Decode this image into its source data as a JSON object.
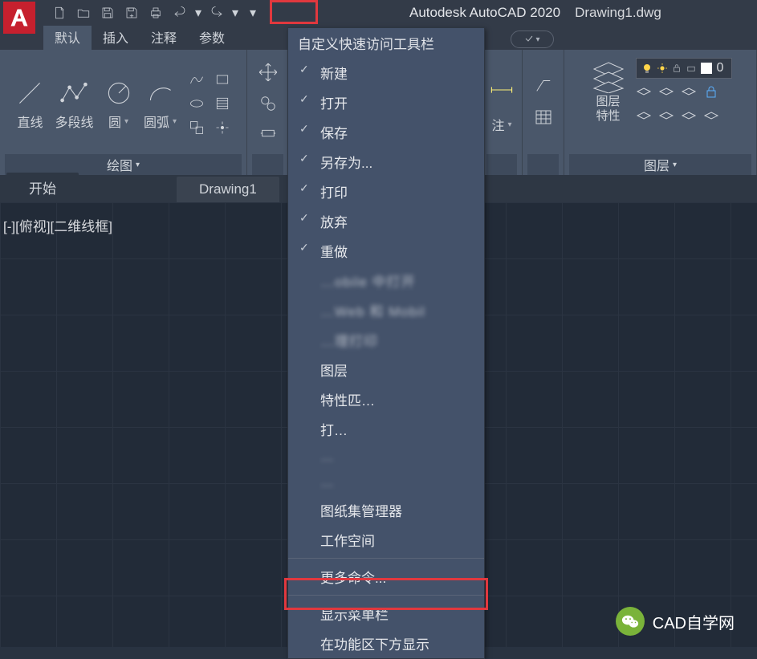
{
  "title": {
    "app": "Autodesk AutoCAD 2020",
    "file": "Drawing1.dwg"
  },
  "app_logo_letter": "A",
  "menutabs": {
    "default": "默认",
    "insert": "插入",
    "annotate": "注释",
    "param": "参数"
  },
  "ribbon": {
    "draw": {
      "line": "直线",
      "pline": "多段线",
      "circle": "圆",
      "arc": "圆弧",
      "group": "绘图"
    },
    "annotate_btn": "注",
    "layer": {
      "props": "图层\n特性",
      "group": "图层",
      "cur_layer": "0"
    }
  },
  "qat_dropdown": {
    "title": "自定义快速访问工具栏",
    "items": [
      {
        "label": "新建",
        "checked": true
      },
      {
        "label": "打开",
        "checked": true
      },
      {
        "label": "保存",
        "checked": true
      },
      {
        "label": "另存为...",
        "checked": true
      },
      {
        "label": "打印",
        "checked": true
      },
      {
        "label": "放弃",
        "checked": true
      },
      {
        "label": "重做",
        "checked": true
      },
      {
        "label": "…obile 中打开",
        "checked": false,
        "blur": true
      },
      {
        "label": "…Web 和 Mobil",
        "checked": false,
        "blur": true
      },
      {
        "label": "…理打印",
        "checked": false,
        "blur": true
      },
      {
        "label": "图层",
        "checked": false
      },
      {
        "label": "特性匹…",
        "checked": false,
        "blur_part": true
      },
      {
        "label": "打…",
        "checked": false,
        "blur_part": true
      },
      {
        "label": "…",
        "checked": false,
        "blur": true
      },
      {
        "label": "…",
        "checked": false,
        "blur": true
      },
      {
        "label": "图纸集管理器",
        "checked": false
      },
      {
        "label": "工作空间",
        "checked": false
      }
    ],
    "more": "更多命令...",
    "show_menu": "显示菜单栏",
    "below_ribbon": "在功能区下方显示"
  },
  "filetabs": {
    "start": "开始",
    "drawing": "Drawing1"
  },
  "viewport": "[-][俯视][二维线框]",
  "watermark": {
    "text": "CAD自学网",
    "icon_glyph": "❧"
  }
}
